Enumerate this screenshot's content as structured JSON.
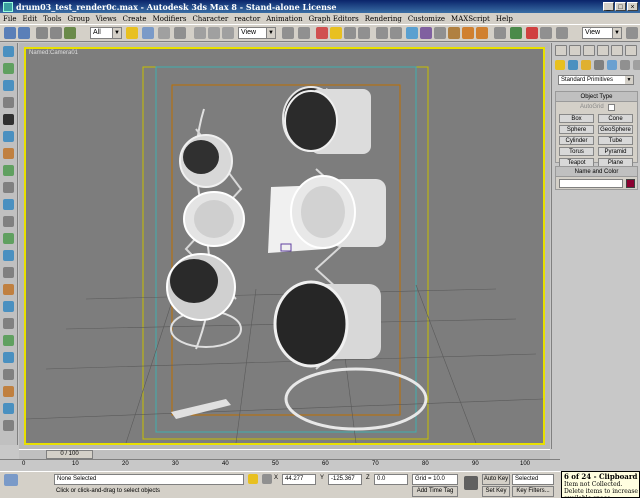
{
  "window": {
    "title": "drum03_test_render0c.max - Autodesk 3ds Max 8 - Stand-alone License",
    "controls": [
      "_",
      "□",
      "×"
    ]
  },
  "menu": [
    "File",
    "Edit",
    "Tools",
    "Group",
    "Views",
    "Create",
    "Modifiers",
    "Character",
    "reactor",
    "Animation",
    "Graph Editors",
    "Rendering",
    "Customize",
    "MAXScript",
    "Help"
  ],
  "toolbar": {
    "selection_filter": "All",
    "coord_system": "View",
    "named_sets": "View"
  },
  "viewport": {
    "label": "Named:Camera01"
  },
  "command_panel": {
    "category": "Standard Primitives",
    "object_type_title": "Object Type",
    "autogrid_label": "AutoGrid",
    "objects": [
      "Box",
      "Cone",
      "Sphere",
      "GeoSphere",
      "Cylinder",
      "Tube",
      "Torus",
      "Pyramid",
      "Teapot",
      "Plane"
    ],
    "name_color_title": "Name and Color",
    "object_color": "#8b0030"
  },
  "time_slider": {
    "frame_display": "0 / 100"
  },
  "track_bar": {
    "ticks": [
      "0",
      "10",
      "20",
      "30",
      "40",
      "50",
      "60",
      "70",
      "80",
      "90",
      "100"
    ]
  },
  "status": {
    "selection": "None Selected",
    "prompt": "Click or click-and-drag to select objects",
    "x_value": "44.277",
    "y_value": "-125.367",
    "z_value": "0.0",
    "grid": "Grid = 10.0",
    "add_time_tag": "Add Time Tag",
    "auto_key": "Auto Key",
    "set_key": "Set Key",
    "key_mode": "Selected",
    "key_filters": "Key Filters..."
  },
  "clipboard": {
    "title": "6 of 24 - Clipboard",
    "message": "Item not Collected. Delete items to increase available space"
  },
  "colors": {
    "viewport_bg": "#7d7d7d",
    "active_border": "#e8e000",
    "title_bar": "#0a246a"
  }
}
